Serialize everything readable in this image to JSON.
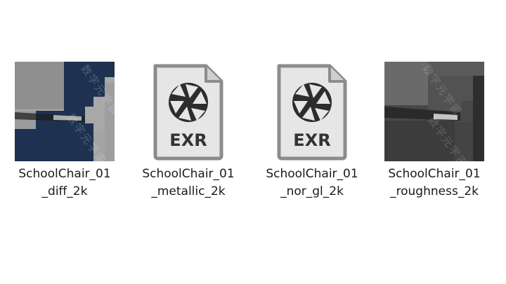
{
  "files": [
    {
      "line1": "SchoolChair_01",
      "line2": "_diff_2k",
      "kind": "image-thumbnail",
      "colors": {
        "navy": "#1e3150",
        "gray": "#9a9a9a"
      }
    },
    {
      "line1": "SchoolChair_01",
      "line2": "_metallic_2k",
      "kind": "exr-file-icon",
      "icon_text": "EXR"
    },
    {
      "line1": "SchoolChair_01",
      "line2": "_nor_gl_2k",
      "kind": "exr-file-icon",
      "icon_text": "EXR"
    },
    {
      "line1": "SchoolChair_01",
      "line2": "_roughness_2k",
      "kind": "image-thumbnail",
      "colors": {
        "dark": "#3c3c3c",
        "mid": "#6a6a6a"
      }
    }
  ],
  "watermark_text": "数字元宇宙"
}
